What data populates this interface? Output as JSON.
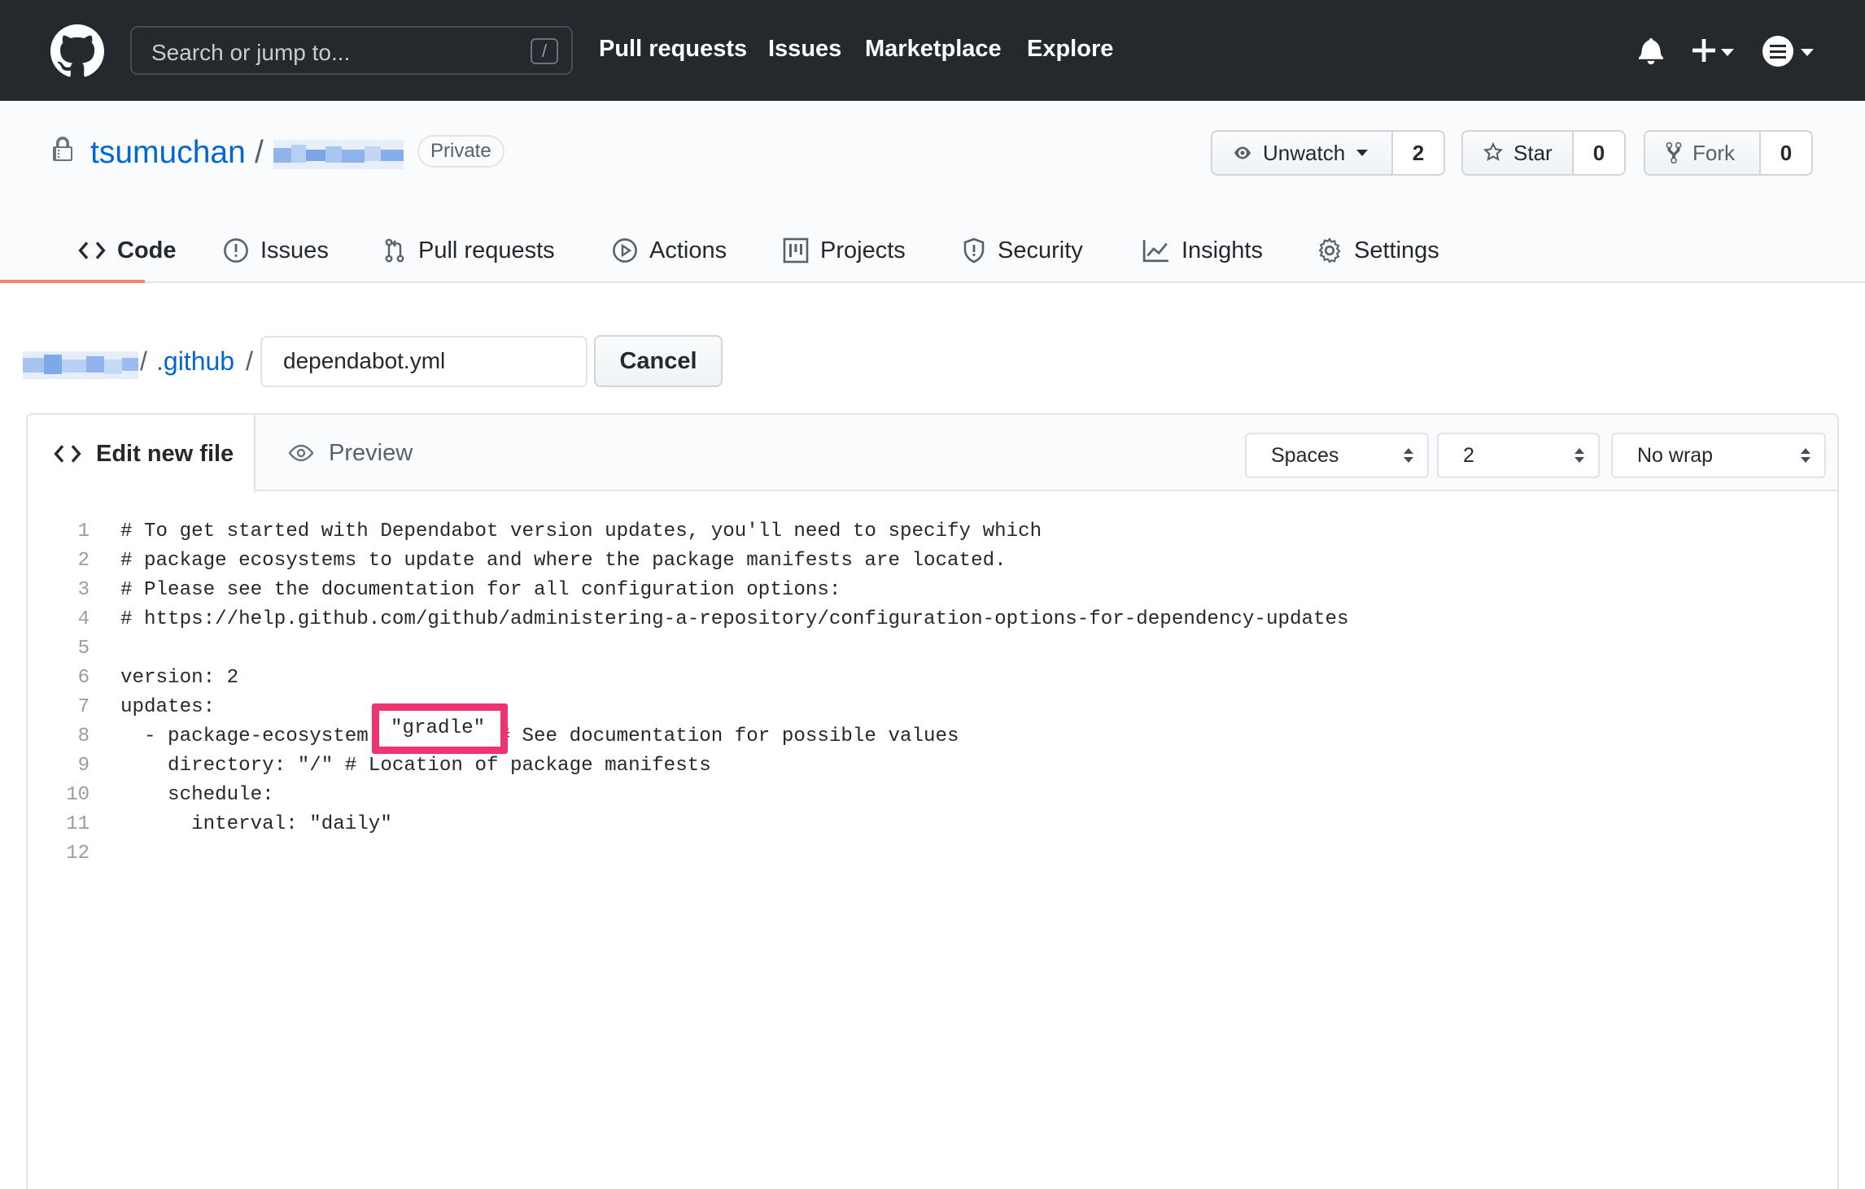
{
  "header": {
    "search_placeholder": "Search or jump to...",
    "search_shortcut": "/",
    "nav": [
      "Pull requests",
      "Issues",
      "Marketplace",
      "Explore"
    ]
  },
  "repo": {
    "owner": "tsumuchan",
    "separator": "/",
    "visibility": "Private",
    "watch": {
      "label": "Unwatch",
      "count": "2"
    },
    "star": {
      "label": "Star",
      "count": "0"
    },
    "fork": {
      "label": "Fork",
      "count": "0"
    },
    "tabs": [
      "Code",
      "Issues",
      "Pull requests",
      "Actions",
      "Projects",
      "Security",
      "Insights",
      "Settings"
    ],
    "active_tab": "Code"
  },
  "path": {
    "sep": "/",
    "folder": ".github",
    "filename": "dependabot.yml",
    "cancel_label": "Cancel"
  },
  "editor": {
    "tab_edit": "Edit new file",
    "tab_preview": "Preview",
    "indent_mode": "Spaces",
    "indent_size": "2",
    "wrap_mode": "No wrap",
    "line_numbers": [
      "1",
      "2",
      "3",
      "4",
      "5",
      "6",
      "7",
      "8",
      "9",
      "10",
      "11",
      "12"
    ],
    "lines": [
      "# To get started with Dependabot version updates, you'll need to specify which",
      "# package ecosystems to update and where the package manifests are located.",
      "# Please see the documentation for all configuration options:",
      "# https://help.github.com/github/administering-a-repository/configuration-options-for-dependency-updates",
      "",
      "version: 2",
      "updates:",
      "  - package-ecosystem: \"gradle\" # See documentation for possible values",
      "    directory: \"/\" # Location of package manifests",
      "    schedule:",
      "      interval: \"daily\"",
      ""
    ],
    "highlighted_value": "\"gradle\""
  },
  "colors": {
    "header_bg": "#24292e",
    "link": "#0366d6",
    "tab_underline": "#f9826c",
    "highlight_border": "#f0326f"
  },
  "icons": [
    "github-logo-icon",
    "bell-icon",
    "plus-icon",
    "menu-icon",
    "lock-icon",
    "eye-icon",
    "star-icon",
    "fork-icon",
    "code-icon",
    "issue-icon",
    "pull-request-icon",
    "play-icon",
    "project-icon",
    "shield-icon",
    "graph-icon",
    "gear-icon",
    "updown-icon"
  ]
}
